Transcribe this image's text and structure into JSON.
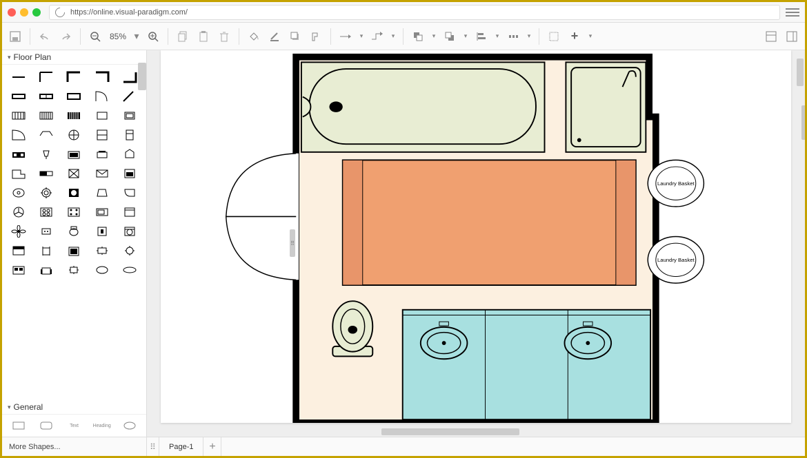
{
  "address_bar": {
    "url": "https://online.visual-paradigm.com/"
  },
  "toolbar": {
    "zoom": "85%"
  },
  "sidebar": {
    "sections": {
      "floorplan": "Floor Plan",
      "general": "General"
    },
    "more_shapes": "More Shapes..."
  },
  "canvas": {
    "labels": {
      "laundry1": "Laundry Basket",
      "laundry2": "Laundry Basket"
    }
  },
  "footer": {
    "page_tab": "Page-1"
  },
  "general_shapes": {
    "text": "Text",
    "heading": "Heading"
  }
}
